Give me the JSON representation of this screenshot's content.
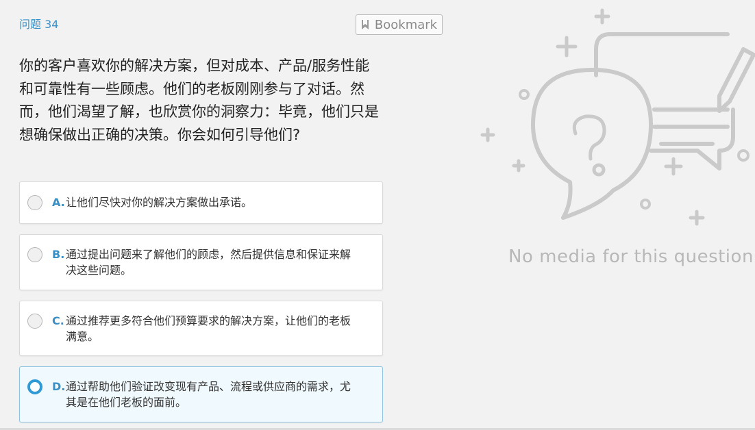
{
  "question": {
    "number_label": "问题 34",
    "text": "你的客户喜欢你的解决方案，但对成本、产品/服务性能和可靠性有一些顾虑。他们的老板刚刚参与了对话。然而，他们渴望了解，也欣赏你的洞察力：毕竟，他们只是想确保做出正确的决策。你会如何引导他们?"
  },
  "bookmark": {
    "label": "Bookmark",
    "icon": "bookmark-icon"
  },
  "options": [
    {
      "letter": "A.",
      "text": "让他们尽快对你的解决方案做出承诺。",
      "selected": false
    },
    {
      "letter": "B.",
      "text": "通过提出问题来了解他们的顾虑，然后提供信息和保证来解决这些问题。",
      "selected": false
    },
    {
      "letter": "C.",
      "text": "通过推荐更多符合他们预算要求的解决方案，让他们的老板满意。",
      "selected": false
    },
    {
      "letter": "D.",
      "text": "通过帮助他们验证改变现有产品、流程或供应商的需求，尤其是在他们老板的面前。",
      "selected": true
    }
  ],
  "media": {
    "placeholder_text": "No media for this question",
    "icon": "chat-question-pencil-illustration"
  },
  "colors": {
    "accent": "#3a8fc7",
    "selected_radio": "#2f9ad6",
    "selected_bg": "#f0f9fd",
    "placeholder_gray": "#c8c8c8"
  }
}
